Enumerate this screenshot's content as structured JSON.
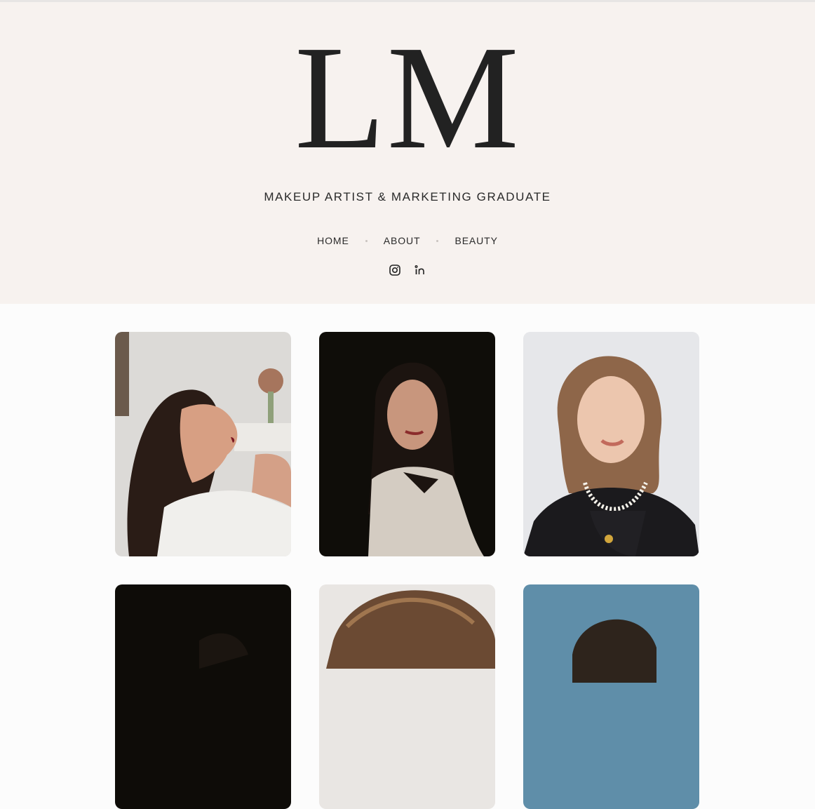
{
  "header": {
    "logo": "LM",
    "tagline": "MAKEUP ARTIST & MARKETING GRADUATE",
    "nav": [
      {
        "label": "HOME"
      },
      {
        "label": "ABOUT"
      },
      {
        "label": "BEAUTY"
      }
    ],
    "social": [
      {
        "icon": "instagram-icon"
      },
      {
        "icon": "linkedin-icon"
      }
    ]
  },
  "colors": {
    "header_bg": "#f7f2ef",
    "page_bg": "#fcfcfc",
    "text": "#222222"
  },
  "gallery": {
    "tiles": [
      {
        "subject": "woman-profile-closed-eyes-red-lips"
      },
      {
        "subject": "woman-dark-background-white-shirt"
      },
      {
        "subject": "woman-curly-hair-pearl-necklace"
      },
      {
        "subject": "dark-portrait-partial"
      },
      {
        "subject": "tousled-hair-portrait-partial"
      },
      {
        "subject": "blue-sky-portrait-partial"
      }
    ]
  }
}
